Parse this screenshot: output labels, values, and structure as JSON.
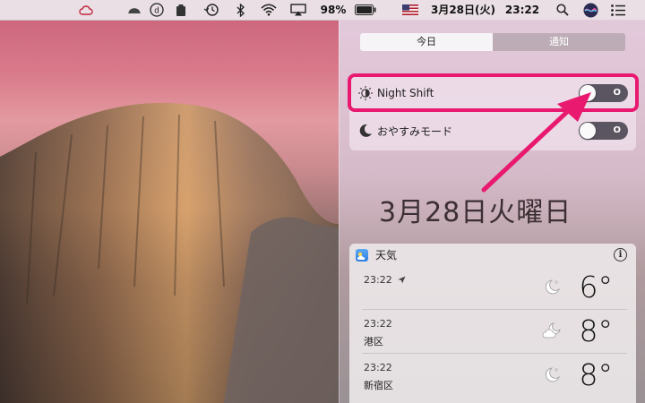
{
  "menubar": {
    "battery": "98%",
    "date": "3月28日(火)",
    "time": "23:22"
  },
  "notification_center": {
    "tabs": [
      {
        "label": "今日",
        "active": true
      },
      {
        "label": "通知",
        "active": false
      }
    ],
    "toggles": [
      {
        "label": "Night Shift",
        "icon": "night-shift-icon",
        "state": "O",
        "on": false
      },
      {
        "label": "おやすみモード",
        "icon": "moon-icon",
        "state": "O",
        "on": false
      }
    ],
    "date_heading": "3月28日火曜日",
    "weather": {
      "title": "天気",
      "rows": [
        {
          "time": "23:22",
          "location_icon": "location-arrow-icon",
          "city": "",
          "condition_icon": "moon-stars-icon",
          "temp": "6°"
        },
        {
          "time": "23:22",
          "city": "港区",
          "condition_icon": "partly-cloudy-night-icon",
          "temp": "8°"
        },
        {
          "time": "23:22",
          "city": "新宿区",
          "condition_icon": "moon-stars-icon",
          "temp": "8°"
        }
      ]
    }
  },
  "colors": {
    "highlight": "#e8196f",
    "switch_off": "#5a5560",
    "menubar": "#ece8ec"
  }
}
